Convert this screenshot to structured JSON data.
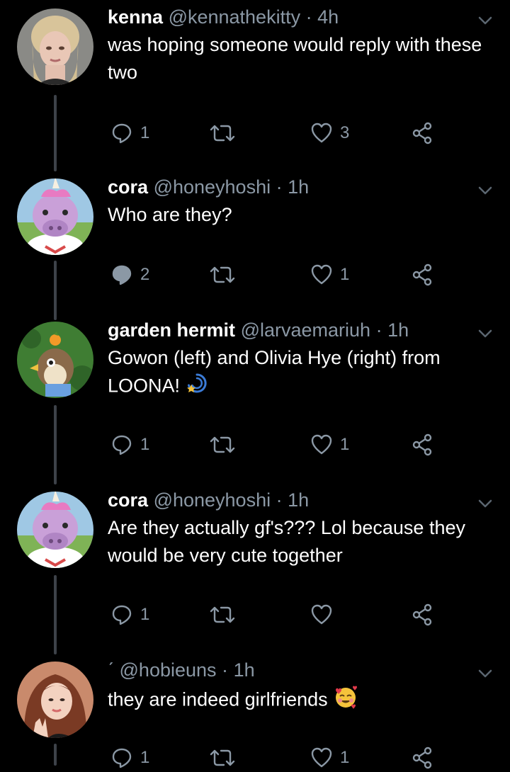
{
  "colors": {
    "background": "#000000",
    "text": "#ffffff",
    "muted": "#8b98a5",
    "thread_line": "#3d4249",
    "emoji_blue": "#3b7bd6",
    "emoji_yellow": "#f5c33b"
  },
  "tweets": [
    {
      "name": "kenna",
      "handle": "@kennathekitty",
      "time": "4h",
      "text": "was hoping someone would reply with these two",
      "avatar": "woman-avatar",
      "reply_count": "1",
      "retweet_count": "",
      "like_count": "3",
      "reply_active": false
    },
    {
      "name": "cora",
      "handle": "@honeyhoshi",
      "time": "1h",
      "text": "Who are they?",
      "avatar": "unicorn-villager-avatar",
      "reply_count": "2",
      "retweet_count": "",
      "like_count": "1",
      "reply_active": true
    },
    {
      "name": "garden hermit",
      "handle": "@larvaemariuh",
      "time": "1h",
      "text": "Gowon (left) and Olivia Hye (right) from LOONA!",
      "emoji": "dizzy-emoji",
      "avatar": "bird-villager-avatar",
      "reply_count": "1",
      "retweet_count": "",
      "like_count": "1",
      "reply_active": false
    },
    {
      "name": "cora",
      "handle": "@honeyhoshi",
      "time": "1h",
      "text": "Are they actually gf's??? Lol because they would be very cute together",
      "avatar": "unicorn-villager-avatar",
      "reply_count": "1",
      "retweet_count": "",
      "like_count": "",
      "reply_active": false
    },
    {
      "name": "ˊ",
      "handle": "@hobieuns",
      "time": "1h",
      "text": "they are indeed girlfriends",
      "emoji": "smiling-face-with-hearts-emoji",
      "avatar": "girl-avatar",
      "reply_count": "1",
      "retweet_count": "",
      "like_count": "1",
      "reply_active": false
    }
  ]
}
